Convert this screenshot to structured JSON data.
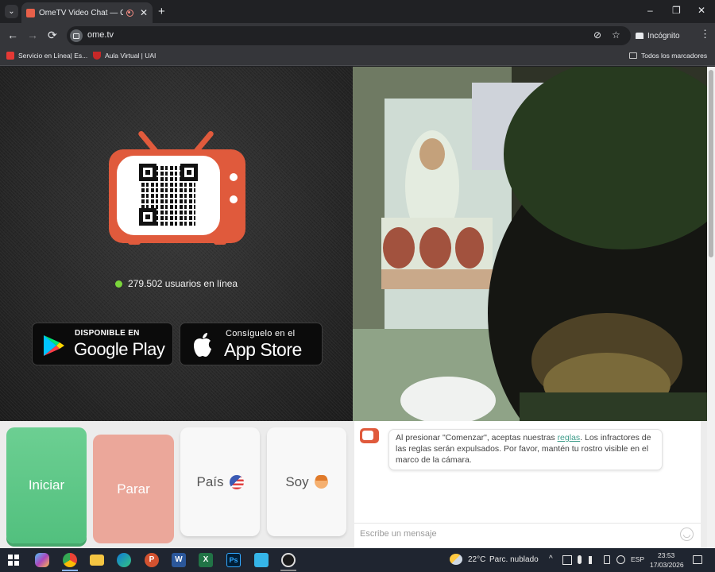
{
  "browser": {
    "tab_title": "OmeTV Video Chat — Ome",
    "tab_close": "✕",
    "new_tab": "+",
    "tab_search_glyph": "⌄",
    "window_controls": {
      "minimize": "–",
      "restore": "❐",
      "close": "✕"
    },
    "nav": {
      "back": "←",
      "forward": "→",
      "reload": "⟳"
    },
    "url": "ome.tv",
    "omnibox_icons": {
      "eye_off": "⊘",
      "star": "☆"
    },
    "incognito_label": "Incógnito",
    "menu_glyph": "⋮",
    "bookmarks": [
      {
        "label": "Servicio en Línea| Es...",
        "icon": "building-icon",
        "color": "#e53935"
      },
      {
        "label": "Aula Virtual | UAI",
        "icon": "crest-icon",
        "color": "#c62828"
      }
    ],
    "all_bookmarks": "Todos los marcadores"
  },
  "page": {
    "online_count": "279.502 usuarios en línea",
    "google_play": {
      "small": "DISPONIBLE EN",
      "big": "Google Play"
    },
    "app_store": {
      "small": "Consíguelo en el",
      "big": "App Store"
    },
    "controls": {
      "start": "Iniciar",
      "stop": "Parar",
      "country": "País",
      "iam": "Soy"
    },
    "chat": {
      "message_before": "Al presionar \"Comenzar\", aceptas nuestras ",
      "rules_link": "reglas",
      "message_after": ". Los infractores de las reglas serán expulsados. Por favor, mantén tu rostro visible en el marco de la cámara.",
      "input_placeholder": "Escribe un mensaje"
    },
    "colors": {
      "brand_orange": "#e05a3c",
      "start_green": "#5ac786",
      "stop_pink": "#eba79a",
      "online_dot": "#7bd63b",
      "link_teal": "#3e9c8a"
    }
  },
  "taskbar": {
    "apps": [
      "windows-start-icon",
      "copilot-icon",
      "chrome-icon",
      "file-explorer-icon",
      "edge-icon",
      "powerpoint-icon",
      "word-icon",
      "excel-icon",
      "photoshop-icon",
      "store-icon",
      "obs-icon"
    ],
    "app_labels": {
      "powerpoint": "P",
      "word": "W",
      "excel": "X",
      "photoshop": "Ps"
    },
    "weather_temp": "22°C",
    "weather_text": "Parc. nublado",
    "tray": {
      "chevron": "^",
      "language": "ESP"
    },
    "time": "23:53",
    "date": "17/03/2026"
  }
}
